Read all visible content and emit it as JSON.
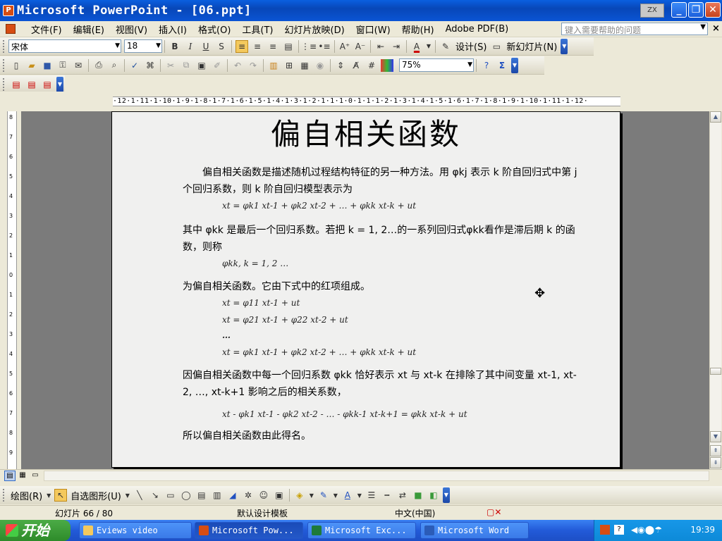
{
  "window": {
    "title": "Microsoft PowerPoint - [06.ppt]",
    "app_icon_letter": "P",
    "ime_indicator": "ZX",
    "controls": {
      "minimize": "_",
      "restore": "❐",
      "close": "✕"
    }
  },
  "menu": {
    "items": [
      "文件(F)",
      "编辑(E)",
      "视图(V)",
      "插入(I)",
      "格式(O)",
      "工具(T)",
      "幻灯片放映(D)",
      "窗口(W)",
      "帮助(H)",
      "Adobe PDF(B)"
    ],
    "help_placeholder": "键入需要帮助的问题"
  },
  "format_toolbar": {
    "font": "宋体",
    "size": "18",
    "bold": "B",
    "italic": "I",
    "underline": "U",
    "shadow": "S",
    "design_label": "设计(S)",
    "new_slide_label": "新幻灯片(N)"
  },
  "standard_toolbar": {
    "zoom": "75%"
  },
  "ruler": {
    "horizontal": "·12·1·11·1·10·1·9·1·8·1·7·1·6·1·5·1·4·1·3·1·2·1·1·1·0·1·1·1·2·1·3·1·4·1·5·1·6·1·7·1·8·1·9·1·10·1·11·1·12·",
    "vertical": [
      "8",
      "7",
      "6",
      "5",
      "4",
      "3",
      "2",
      "1",
      "0",
      "1",
      "2",
      "3",
      "4",
      "5",
      "6",
      "7",
      "8",
      "9"
    ]
  },
  "slide": {
    "title": "偏自相关函数",
    "para1": "偏自相关函数是描述随机过程结构特征的另一种方法。用 φkj 表示 k 阶自回归式中第 j 个回归系数，则 k 阶自回归模型表示为",
    "formula1": "xt = φk1 xt-1 + φk2 xt-2 + … + φkk xt-k + ut",
    "para2": "其中 φkk 是最后一个回归系数。若把 k = 1, 2…的一系列回归式φkk看作是滞后期 k 的函数，则称",
    "formula2": "φkk,   k = 1, 2 …",
    "para3": "为偏自相关函数。它由下式中的红项组成。",
    "formula3a": "xt = φ11 xt-1 + ut",
    "formula3b": "xt = φ21 xt-1 + φ22 xt-2 + ut",
    "formula3c": "…",
    "formula3d": "xt = φk1 xt-1 + φk2 xt-2 + … + φkk xt-k + ut",
    "para4": "因偏自相关函数中每一个回归系数 φkk 恰好表示 xt 与 xt-k 在排除了其中间变量 xt-1, xt-2, …, xt-k+1 影响之后的相关系数，",
    "formula4": "xt - φk1 xt-1 - φk2 xt-2 - … - φkk-1 xt-k+1 = φkk xt-k + ut",
    "para5": "所以偏自相关函数由此得名。"
  },
  "drawing_toolbar": {
    "draw_label": "绘图(R)",
    "autoshapes_label": "自选图形(U)"
  },
  "status": {
    "slide_counter": "幻灯片 66 / 80",
    "template": "默认设计模板",
    "language": "中文(中国)"
  },
  "taskbar": {
    "start_label": "开始",
    "tasks": [
      "Eviews video",
      "Microsoft Pow...",
      "Microsoft Exc...",
      "Microsoft Word"
    ],
    "clock": "19:39"
  },
  "colors": {
    "titlebar": "#0a54d4",
    "taskbar": "#225ad8",
    "start_button": "#2e8b2a",
    "slide_background": "#f0f0ef",
    "workspace": "#7b7b7b"
  }
}
